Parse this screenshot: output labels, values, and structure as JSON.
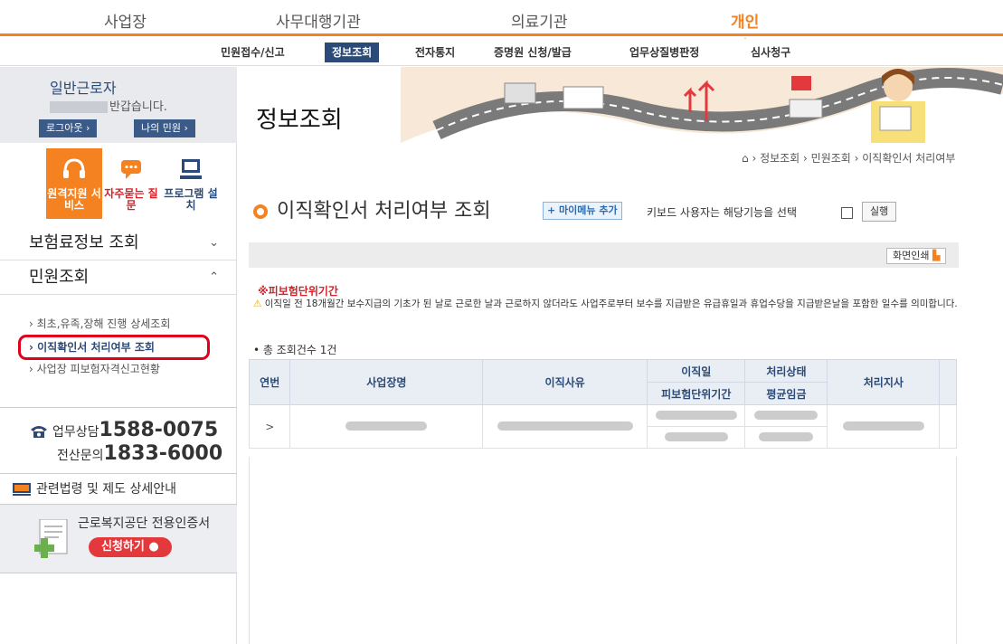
{
  "topnav": [
    "사업장",
    "사무대행기관",
    "의료기관",
    "개인"
  ],
  "subnav": [
    "민원접수/신고",
    "정보조회",
    "전자통지",
    "증명원 신청/발급",
    "업무상질병판정",
    "심사청구"
  ],
  "user": {
    "type": "일반근로자",
    "greeting": "반갑습니다.",
    "logout": "로그아웃",
    "my": "나의 민원"
  },
  "quick": {
    "remote": "원격지원 서비스",
    "faq": "자주묻는 질문",
    "install": "프로그램 설치"
  },
  "menu": {
    "insurance": "보험료정보 조회",
    "civil": "민원조회",
    "items": [
      "최초,유족,장해 진행 상세조회",
      "이직확인서 처리여부 조회",
      "사업장 피보험자격신고현황"
    ]
  },
  "contact": {
    "work_label": "업무상담",
    "work": "1588-0075",
    "pc_label": "전산문의",
    "pc": "1833-6000",
    "law": "관련법령 및 제도 상세안내",
    "cert": "근로복지공단 전용인증서",
    "apply": "신청하기"
  },
  "page": {
    "title": "정보조회",
    "breadcrumb": "› 정보조회 › 민원조회 › 이직확인서 처리여부",
    "heading": "이직확인서 처리여부 조회",
    "mymenu": "+ 마이메뉴 추가",
    "kbd": "키보드 사용자는 해당기능을 선택",
    "run": "실행",
    "print": "화면인쇄",
    "note_title": "※피보험단위기간",
    "note": "이직일 전 18개월간 보수지급의 기초가 된 날로 근로한 날과 근로하지 않더라도 사업주로부터 보수를 지급받은 유급휴일과 휴업수당을 지급받은날을 포함한 일수를 의미합니다.",
    "count": "• 총 조회건수 1건"
  },
  "table": {
    "h_no": "연번",
    "h_company": "사업장명",
    "h_reason": "이직사유",
    "h_date": "이직일",
    "h_period": "피보험단위기간",
    "h_status": "처리상태",
    "h_wage": "평균임금",
    "h_branch": "처리지사",
    "row_arrow": ">"
  },
  "colors": {
    "accent": "#f58220",
    "navy": "#2b4a78",
    "red": "#e0001a"
  }
}
